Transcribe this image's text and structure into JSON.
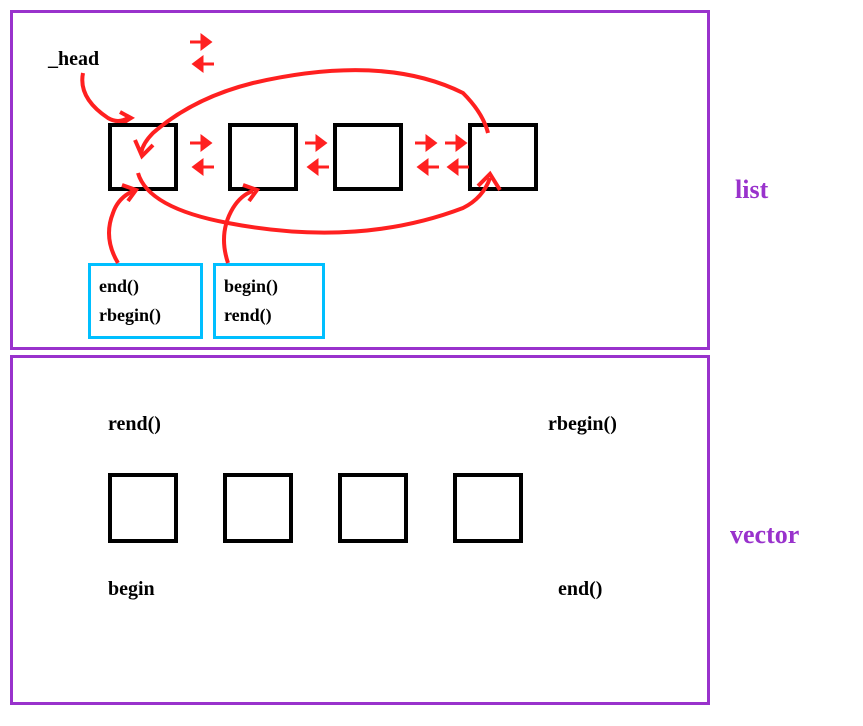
{
  "labels": {
    "list": "list",
    "vector": "vector",
    "head": "_head"
  },
  "list_panel": {
    "iterator_box_1": {
      "line1": "end()",
      "line2": "rbegin()"
    },
    "iterator_box_2": {
      "line1": "begin()",
      "line2": "rend()"
    }
  },
  "vector_panel": {
    "rend": "rend()",
    "rbegin": "rbegin()",
    "begin": "begin",
    "end": "end()"
  },
  "chart_data": {
    "type": "diagram",
    "title": "C++ list vs vector iterator diagram",
    "panels": [
      {
        "name": "list",
        "description": "Doubly-linked list with sentinel _head node. Four nodes shown with bidirectional pointers (forward and backward arrows between adjacent nodes). Last node wraps back to head. end() and rbegin() point to head node; begin() and rend() point to first real node.",
        "nodes": 4,
        "iterators": [
          {
            "name": "end()",
            "points_to": "head"
          },
          {
            "name": "rbegin()",
            "points_to": "head"
          },
          {
            "name": "begin()",
            "points_to": "first_node"
          },
          {
            "name": "rend()",
            "points_to": "first_node"
          }
        ],
        "circular": true,
        "bidirectional": true
      },
      {
        "name": "vector",
        "description": "Contiguous array of 4 elements. begin points to first element, end() past last. rbegin() at logical last position (right of last), rend() before first.",
        "nodes": 4,
        "iterators": [
          {
            "name": "begin",
            "points_to": "first_element"
          },
          {
            "name": "end()",
            "points_to": "past_last"
          },
          {
            "name": "rbegin()",
            "points_to": "past_last_reverse"
          },
          {
            "name": "rend()",
            "points_to": "before_first_reverse"
          }
        ],
        "circular": false,
        "bidirectional": false
      }
    ]
  }
}
